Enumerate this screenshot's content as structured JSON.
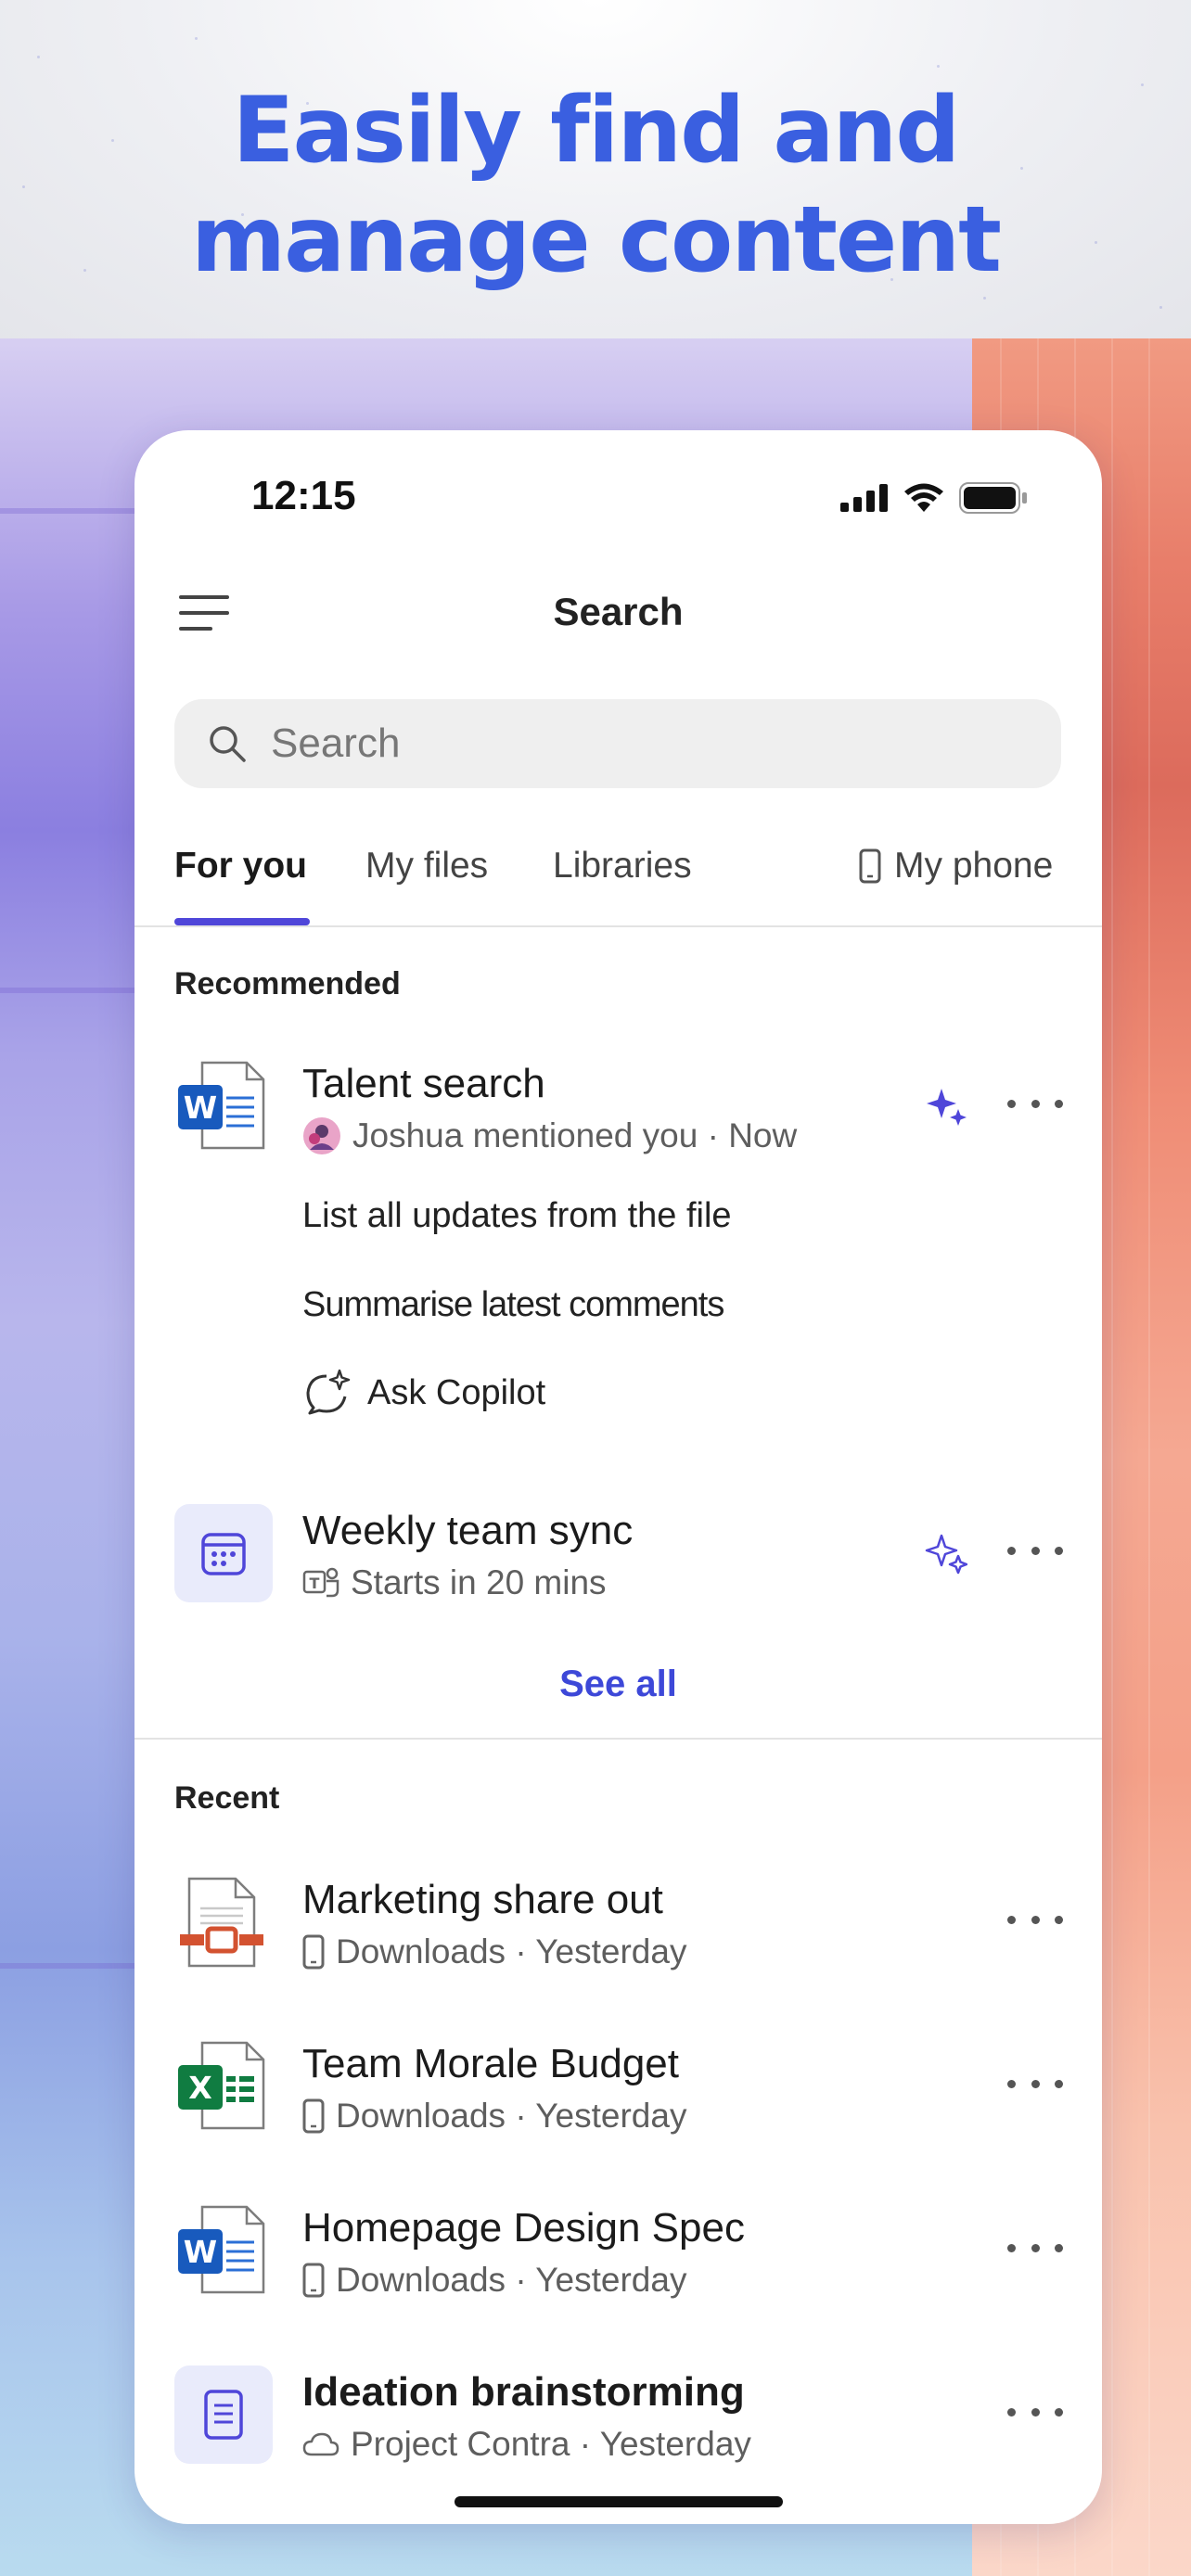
{
  "marketing": {
    "headline_line1": "Easily find and",
    "headline_line2": "manage content"
  },
  "status_bar": {
    "time": "12:15"
  },
  "header": {
    "title": "Search"
  },
  "search": {
    "placeholder": "Search"
  },
  "tabs": [
    {
      "label": "For you",
      "active": true
    },
    {
      "label": "My files",
      "active": false
    },
    {
      "label": "Libraries",
      "active": false
    },
    {
      "label": "My phone",
      "active": false,
      "icon": "phone-icon"
    }
  ],
  "recommended": {
    "label": "Recommended",
    "items": [
      {
        "name": "Talent search",
        "meta": "Joshua mentioned you · Now",
        "file_icon": "word-icon",
        "suggestions": [
          "List all updates from the file",
          "Summarise latest comments"
        ],
        "ask_label": "Ask Copilot"
      },
      {
        "name": "Weekly team sync",
        "meta": "Starts in 20 mins",
        "file_icon": "calendar-icon",
        "meta_icon": "teams-icon"
      }
    ],
    "see_all": "See all"
  },
  "recent": {
    "label": "Recent",
    "items": [
      {
        "name": "Marketing share out",
        "meta": "Downloads · Yesterday",
        "file_icon": "powerpoint-icon",
        "meta_icon": "phone-icon"
      },
      {
        "name": "Team Morale Budget",
        "meta": "Downloads · Yesterday",
        "file_icon": "excel-icon",
        "meta_icon": "phone-icon"
      },
      {
        "name": "Homepage Design Spec",
        "meta": "Downloads · Yesterday",
        "file_icon": "word-icon",
        "meta_icon": "phone-icon"
      },
      {
        "name": "Ideation brainstorming",
        "meta": "Project Contra · Yesterday",
        "file_icon": "document-icon",
        "meta_icon": "cloud-icon"
      }
    ]
  },
  "colors": {
    "accent": "#4f46d9",
    "headline": "#3a5fe0",
    "link": "#3d48d8"
  }
}
